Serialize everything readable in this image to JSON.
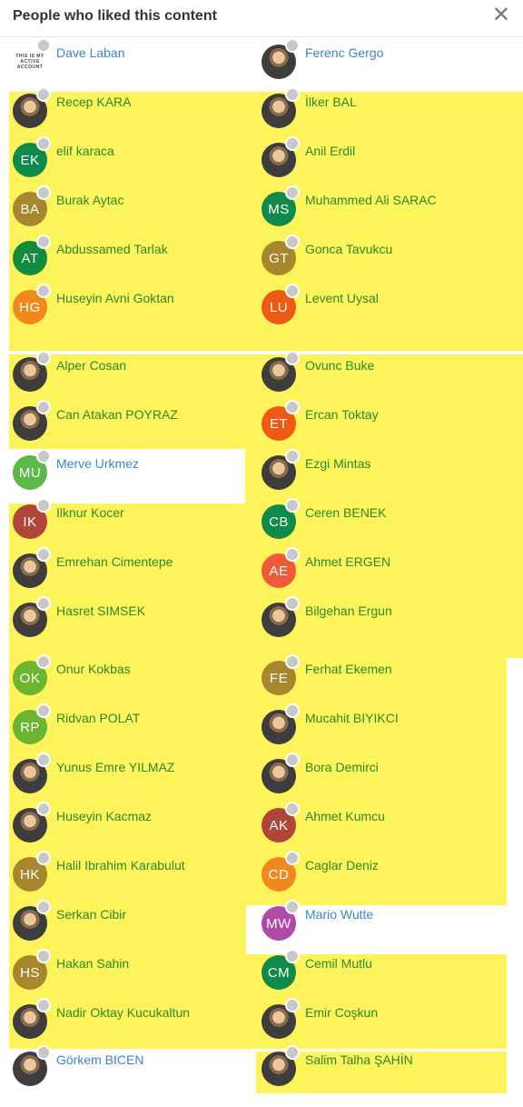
{
  "dialog": {
    "title": "People who liked this content",
    "close_label": "✕"
  },
  "people": [
    {
      "name": "Dave Laban",
      "initials": "",
      "color": "",
      "kind": "logo",
      "logo_text": [
        "THIS IS MY",
        "ACTIVE",
        "ACCOUNT"
      ],
      "highlight": false
    },
    {
      "name": "Ferenc Gergo",
      "initials": "",
      "color": "",
      "kind": "photo",
      "highlight": false
    },
    {
      "name": "Recep KARA",
      "initials": "",
      "color": "",
      "kind": "photo",
      "highlight": true
    },
    {
      "name": "İlker BAL",
      "initials": "",
      "color": "",
      "kind": "photo",
      "highlight": true
    },
    {
      "name": "elif karaca",
      "initials": "EK",
      "color": "#0f8a4a",
      "kind": "initials",
      "highlight": true
    },
    {
      "name": "Anil Erdil",
      "initials": "",
      "color": "",
      "kind": "photo",
      "highlight": true
    },
    {
      "name": "Burak Aytac",
      "initials": "BA",
      "color": "#a7862e",
      "kind": "initials",
      "highlight": true
    },
    {
      "name": "Muhammed Ali SARAC",
      "initials": "MS",
      "color": "#0f8a4a",
      "kind": "initials",
      "highlight": true
    },
    {
      "name": "Abdussamed Tarlak",
      "initials": "AT",
      "color": "#128c3c",
      "kind": "initials",
      "highlight": true
    },
    {
      "name": "Gonca Tavukcu",
      "initials": "GT",
      "color": "#a7862e",
      "kind": "initials",
      "highlight": true
    },
    {
      "name": "Huseyin Avni Goktan",
      "initials": "HG",
      "color": "#f0881d",
      "kind": "initials",
      "highlight": true
    },
    {
      "name": "Levent Uysal",
      "initials": "LU",
      "color": "#ee5a14",
      "kind": "initials",
      "highlight": true
    },
    {
      "name": "Alper Cosan",
      "initials": "",
      "color": "",
      "kind": "photo",
      "highlight": true
    },
    {
      "name": "Ovunc Buke",
      "initials": "",
      "color": "",
      "kind": "photo",
      "highlight": true
    },
    {
      "name": "Can Atakan POYRAZ",
      "initials": "",
      "color": "",
      "kind": "photo",
      "highlight": true
    },
    {
      "name": "Ercan Toktay",
      "initials": "ET",
      "color": "#ee5a14",
      "kind": "initials",
      "highlight": true
    },
    {
      "name": "Merve Urkmez",
      "initials": "MU",
      "color": "#5bb84a",
      "kind": "initials",
      "highlight": false
    },
    {
      "name": "Ezgi Mintas",
      "initials": "",
      "color": "",
      "kind": "photo",
      "highlight": true
    },
    {
      "name": "Ilknur Kocer",
      "initials": "IK",
      "color": "#b0453a",
      "kind": "initials",
      "highlight": true
    },
    {
      "name": "Ceren BENEK",
      "initials": "CB",
      "color": "#0f8a4a",
      "kind": "initials",
      "highlight": true
    },
    {
      "name": "Emrehan Cimentepe",
      "initials": "",
      "color": "",
      "kind": "photo",
      "highlight": true
    },
    {
      "name": "Ahmet ERGEN",
      "initials": "AE",
      "color": "#f05a3a",
      "kind": "initials",
      "highlight": true
    },
    {
      "name": "Hasret SIMSEK",
      "initials": "",
      "color": "",
      "kind": "photo",
      "highlight": true
    },
    {
      "name": "Bilgehan Ergun",
      "initials": "",
      "color": "",
      "kind": "photo",
      "highlight": true
    },
    {
      "name": "Onur Kokbas",
      "initials": "OK",
      "color": "#6db52e",
      "kind": "initials",
      "highlight": true
    },
    {
      "name": "Ferhat Ekemen",
      "initials": "FE",
      "color": "#a7862e",
      "kind": "initials",
      "highlight": true
    },
    {
      "name": "Ridvan POLAT",
      "initials": "RP",
      "color": "#6db52e",
      "kind": "initials",
      "highlight": true
    },
    {
      "name": "Mucahit BIYIKCI",
      "initials": "",
      "color": "",
      "kind": "photo",
      "highlight": true
    },
    {
      "name": "Yunus Emre YILMAZ",
      "initials": "",
      "color": "",
      "kind": "photo",
      "highlight": true
    },
    {
      "name": "Bora Demirci",
      "initials": "",
      "color": "",
      "kind": "photo",
      "highlight": true
    },
    {
      "name": "Huseyin Kacmaz",
      "initials": "",
      "color": "",
      "kind": "photo",
      "highlight": true
    },
    {
      "name": "Ahmet Kumcu",
      "initials": "AK",
      "color": "#b0453a",
      "kind": "initials",
      "highlight": true
    },
    {
      "name": "Halil Ibrahim Karabulut",
      "initials": "HK",
      "color": "#a7862e",
      "kind": "initials",
      "highlight": true
    },
    {
      "name": "Caglar Deniz",
      "initials": "CD",
      "color": "#f0881d",
      "kind": "initials",
      "highlight": true
    },
    {
      "name": "Serkan Cibir",
      "initials": "",
      "color": "",
      "kind": "photo",
      "highlight": true
    },
    {
      "name": "Mario Wutte",
      "initials": "MW",
      "color": "#b04aa8",
      "kind": "initials",
      "highlight": false
    },
    {
      "name": "Hakan Sahin",
      "initials": "HS",
      "color": "#a7862e",
      "kind": "initials",
      "highlight": true
    },
    {
      "name": "Cemil Mutlu",
      "initials": "CM",
      "color": "#0f8a4a",
      "kind": "initials",
      "highlight": true
    },
    {
      "name": "Nadir Oktay Kucukaltun",
      "initials": "",
      "color": "",
      "kind": "photo",
      "highlight": true
    },
    {
      "name": "Emir Coşkun",
      "initials": "",
      "color": "",
      "kind": "photo",
      "highlight": true
    },
    {
      "name": "Görkem BICEN",
      "initials": "",
      "color": "",
      "kind": "photo",
      "highlight": false
    },
    {
      "name": "Salim Talha ŞAHİN",
      "initials": "",
      "color": "",
      "kind": "photo",
      "highlight": true
    }
  ]
}
